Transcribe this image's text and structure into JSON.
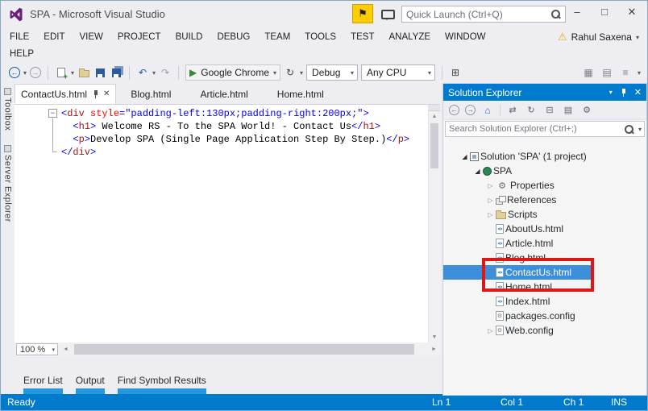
{
  "titlebar": {
    "title": "SPA - Microsoft Visual Studio",
    "quick_launch_placeholder": "Quick Launch (Ctrl+Q)"
  },
  "menu": {
    "row1": [
      "FILE",
      "EDIT",
      "VIEW",
      "PROJECT",
      "BUILD",
      "DEBUG",
      "TEAM",
      "TOOLS",
      "TEST",
      "ANALYZE",
      "WINDOW"
    ],
    "row2": [
      "HELP"
    ],
    "user": "Rahul Saxena"
  },
  "toolbar": {
    "run_target": "Google Chrome",
    "config": "Debug",
    "platform": "Any CPU"
  },
  "left_rail": [
    "Toolbox",
    "Server Explorer"
  ],
  "editor": {
    "tabs": [
      {
        "label": "ContactUs.html",
        "active": true
      },
      {
        "label": "Blog.html",
        "active": false
      },
      {
        "label": "Article.html",
        "active": false
      },
      {
        "label": "Home.html",
        "active": false
      }
    ],
    "zoom": "100 %",
    "code_lines": [
      [
        {
          "t": "d",
          "s": "<"
        },
        {
          "t": "tag",
          "s": "div"
        },
        {
          "t": "pl",
          "s": " "
        },
        {
          "t": "attr",
          "s": "style"
        },
        {
          "t": "d",
          "s": "="
        },
        {
          "t": "str",
          "s": "\"padding-left:130px;padding-right:200px;\""
        },
        {
          "t": "d",
          "s": ">"
        }
      ],
      [
        {
          "t": "pl",
          "s": "  "
        },
        {
          "t": "d",
          "s": "<"
        },
        {
          "t": "tag",
          "s": "h1"
        },
        {
          "t": "d",
          "s": ">"
        },
        {
          "t": "pl",
          "s": " Welcome RS - To the SPA World! - Contact Us"
        },
        {
          "t": "d",
          "s": "</"
        },
        {
          "t": "tag",
          "s": "h1"
        },
        {
          "t": "d",
          "s": ">"
        }
      ],
      [
        {
          "t": "pl",
          "s": "  "
        },
        {
          "t": "d",
          "s": "<"
        },
        {
          "t": "tag",
          "s": "p"
        },
        {
          "t": "d",
          "s": ">"
        },
        {
          "t": "pl",
          "s": "Develop SPA (Single Page Application Step By Step.)"
        },
        {
          "t": "d",
          "s": "</"
        },
        {
          "t": "tag",
          "s": "p"
        },
        {
          "t": "d",
          "s": ">"
        }
      ],
      [
        {
          "t": "d",
          "s": "</"
        },
        {
          "t": "tag",
          "s": "div"
        },
        {
          "t": "d",
          "s": ">"
        }
      ]
    ]
  },
  "panel_tabs": [
    "Error List",
    "Output",
    "Find Symbol Results"
  ],
  "status": {
    "ready": "Ready",
    "ln": "Ln 1",
    "col": "Col 1",
    "ch": "Ch 1",
    "mode": "INS"
  },
  "solution_explorer": {
    "title": "Solution Explorer",
    "search_placeholder": "Search Solution Explorer (Ctrl+;)",
    "tree": [
      {
        "label": "Solution 'SPA' (1 project)",
        "indent": 0,
        "icon": "solution",
        "arrow": "expanded"
      },
      {
        "label": "SPA",
        "indent": 1,
        "icon": "project",
        "arrow": "expanded"
      },
      {
        "label": "Properties",
        "indent": 2,
        "icon": "properties",
        "arrow": "collapsed"
      },
      {
        "label": "References",
        "indent": 2,
        "icon": "references",
        "arrow": "collapsed"
      },
      {
        "label": "Scripts",
        "indent": 2,
        "icon": "folder",
        "arrow": "collapsed"
      },
      {
        "label": "AboutUs.html",
        "indent": 2,
        "icon": "html"
      },
      {
        "label": "Article.html",
        "indent": 2,
        "icon": "html"
      },
      {
        "label": "Blog.html",
        "indent": 2,
        "icon": "html"
      },
      {
        "label": "ContactUs.html",
        "indent": 2,
        "icon": "html",
        "selected": true
      },
      {
        "label": "Home.html",
        "indent": 2,
        "icon": "html"
      },
      {
        "label": "Index.html",
        "indent": 2,
        "icon": "html"
      },
      {
        "label": "packages.config",
        "indent": 2,
        "icon": "config"
      },
      {
        "label": "Web.config",
        "indent": 2,
        "icon": "config",
        "arrow": "collapsed"
      }
    ]
  },
  "icons": {
    "dropdown": "▾",
    "nav_back": "←",
    "nav_forward": "→",
    "undo": "↶",
    "redo": "↷",
    "play": "▶",
    "refresh": "↻",
    "minimize": "–",
    "maximize": "□",
    "close": "✕",
    "flag": "⚑",
    "warning": "⚠",
    "home": "⌂",
    "sync": "⇄",
    "collapse_all": "⊟",
    "show_all": "▤",
    "gear": "⚙",
    "overflow": "≡",
    "up": "▲",
    "down": "▼",
    "left": "◄",
    "right": "►",
    "generic1": "▦",
    "generic2": "⊞",
    "generic3": "▤"
  }
}
